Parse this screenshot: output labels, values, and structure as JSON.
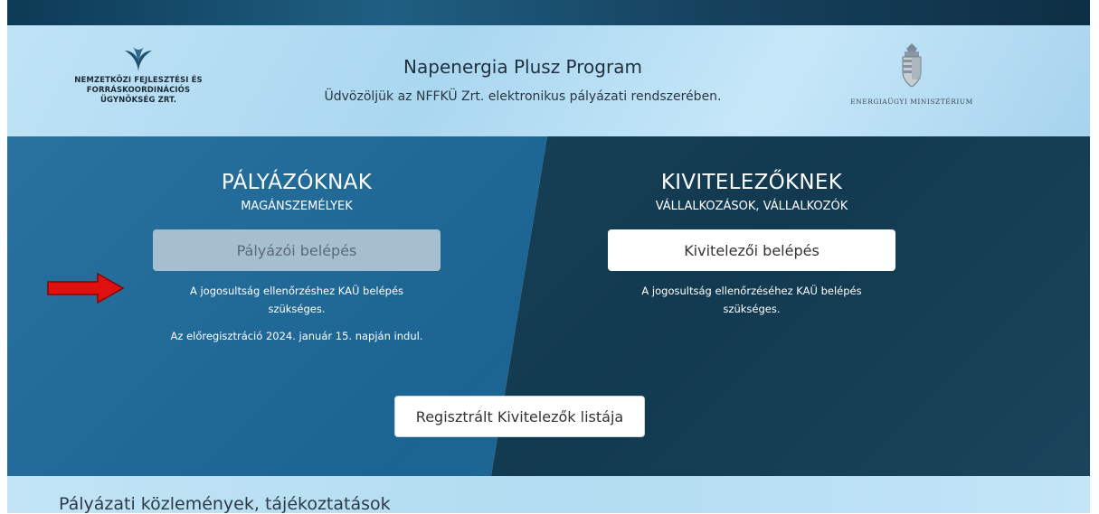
{
  "header": {
    "org_name_lines": [
      "NEMZETKÖZI FEJLESZTÉSI ÉS",
      "FORRÁSKOORDINÁCIÓS",
      "ÜGYNÖKSÉG ZRT."
    ],
    "title": "Napenergia Plusz Program",
    "subtitle": "Üdvözöljük az NFFKÜ Zrt. elektronikus pályázati rendszerében.",
    "ministry": "ENERGIAÜGYI MINISZTÉRIUM",
    "left_logo_icon": "leaf-logo-icon",
    "right_logo_icon": "coat-of-arms-icon"
  },
  "applicants": {
    "title": "PÁLYÁZÓKNAK",
    "subtitle": "MAGÁNSZEMÉLYEK",
    "login_button": "Pályázói belépés",
    "note": "A jogosultság ellenőrzéshez KAÜ belépés szükséges.",
    "note2": "Az előregisztráció 2024. január 15. napján indul."
  },
  "contractors": {
    "title": "KIVITELEZŐKNEK",
    "subtitle": "VÁLLALKOZÁSOK, VÁLLALKOZÓK",
    "login_button": "Kivitelezői belépés",
    "note": "A jogosultság ellenőrzéséhez KAÜ belépés szükséges."
  },
  "registered_list_button": "Regisztrált Kivitelezők listája",
  "announcements": {
    "title": "Pályázati közlemények, tájékoztatások"
  },
  "colors": {
    "left_panel": "#1d6a9a",
    "right_panel": "#133e56",
    "header_bg": "#b6ddf3",
    "arrow": "#e01010"
  }
}
